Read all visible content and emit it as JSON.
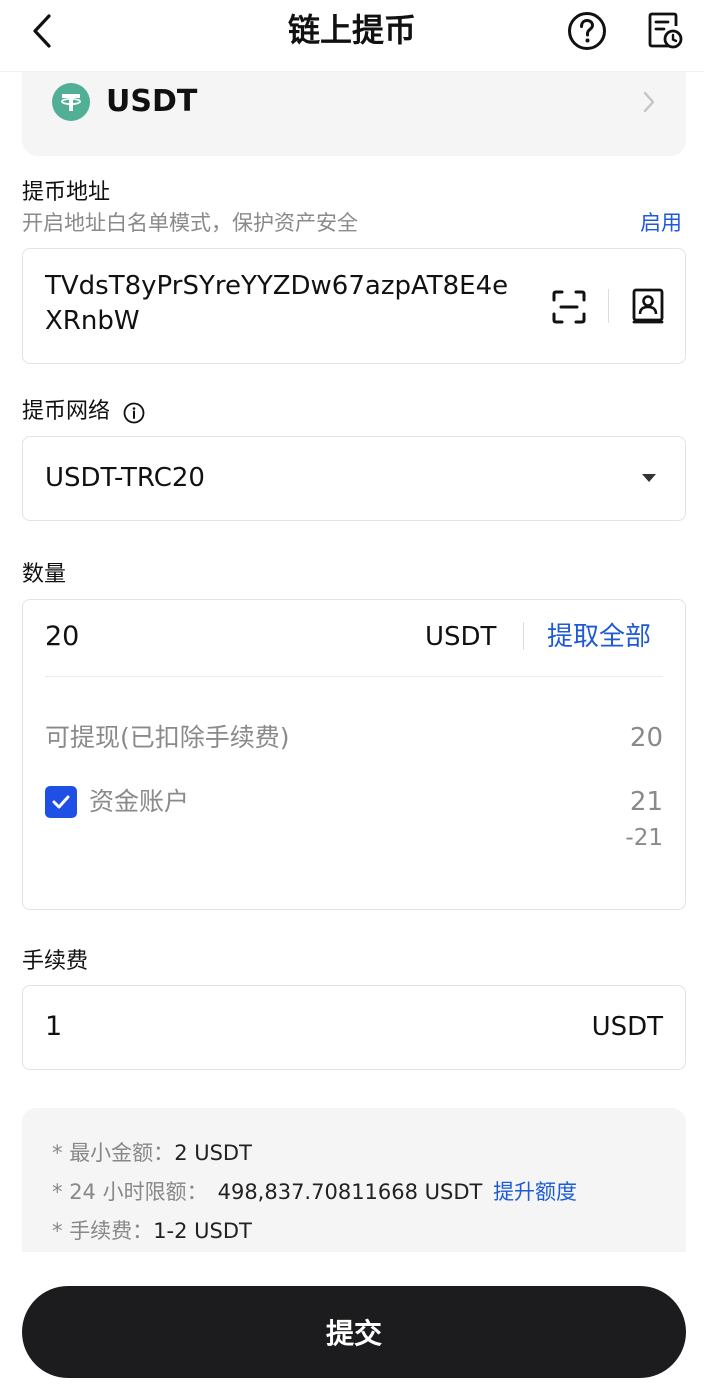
{
  "header": {
    "title": "链上提币"
  },
  "coin": {
    "name": "USDT",
    "brand_color": "#50af95"
  },
  "address": {
    "label": "提币地址",
    "whitelist_hint": "开启地址白名单模式，保护资产安全",
    "whitelist_action": "启用",
    "value": "TVdsT8yPrSYreYYZDw67azpAT8E4eXRnbW"
  },
  "network": {
    "label": "提币网络",
    "selected": "USDT-TRC20"
  },
  "amount": {
    "label": "数量",
    "value": "20",
    "unit": "USDT",
    "all_action": "提取全部",
    "available_label": "可提现(已扣除手续费)",
    "available_value": "20",
    "funding_label": "资金账户",
    "funding_value": "21",
    "funding_delta": "-21",
    "funding_checked": true
  },
  "fee": {
    "label": "手续费",
    "value": "1",
    "unit": "USDT"
  },
  "notes": {
    "min_label": "最小金额：",
    "min_value": "2 USDT",
    "limit_label": "24 小时限额：",
    "limit_value": "498,837.70811668 USDT",
    "limit_action": "提升额度",
    "fee_label": "手续费：",
    "fee_value": "1-2 USDT"
  },
  "submit_label": "提交",
  "colors": {
    "accent": "#1e5ad6",
    "checkbox": "#1e50e6",
    "submit_bg": "#1c1c1e"
  }
}
